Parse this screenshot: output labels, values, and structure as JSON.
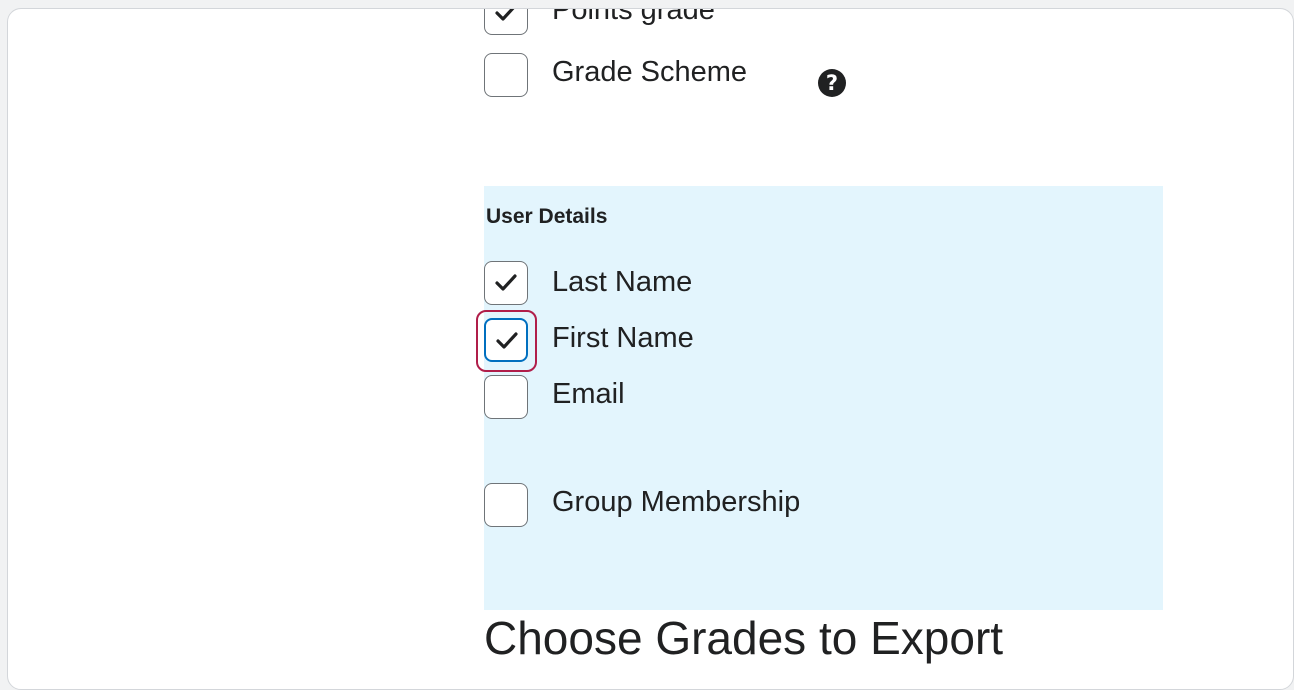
{
  "grade_options": {
    "points_grade_label": "Points grade",
    "points_grade_checked": true,
    "grade_scheme_label": "Grade Scheme",
    "grade_scheme_checked": false,
    "help_icon_glyph": "?"
  },
  "user_details": {
    "title": "User Details",
    "items": [
      {
        "label": "Last Name",
        "checked": true
      },
      {
        "label": "First Name",
        "checked": true,
        "focused": true
      },
      {
        "label": "Email",
        "checked": false
      },
      {
        "label": "Group Membership",
        "checked": false
      }
    ]
  },
  "next_section": {
    "heading": "Choose Grades to Export"
  },
  "colors": {
    "panel_bg": "#e3f5fd",
    "focus_ring": "#b01e4a",
    "focus_border": "#006fbf",
    "text": "#202122"
  },
  "icons": {
    "checkmark": "checkmark-icon",
    "help": "help-icon"
  }
}
